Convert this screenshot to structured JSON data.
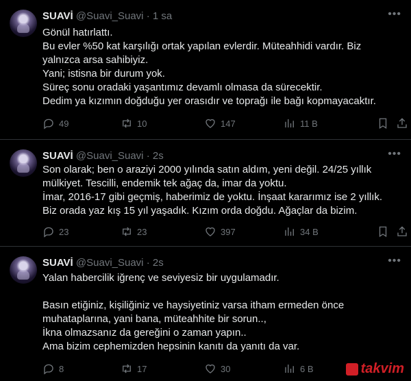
{
  "tweets": [
    {
      "name": "SUAVİ",
      "handle": "@Suavi_Suavi",
      "separator": "·",
      "time": "1 sa",
      "lines": [
        "Gönül hatırlattı.",
        "Bu evler %50 kat karşılığı ortak yapılan evlerdir. Müteahhidi vardır. Biz",
        "yalnızca arsa sahibiyiz.",
        "Yani; istisna bir durum yok.",
        "Süreç sonu oradaki yaşantımız devamlı olmasa da sürecektir.",
        "Dedim ya kızımın doğduğu yer orasıdır ve toprağı ile bağı kopmayacaktır."
      ],
      "replies": "49",
      "reposts": "10",
      "likes": "147",
      "views": "11 B"
    },
    {
      "name": "SUAVİ",
      "handle": "@Suavi_Suavi",
      "separator": "·",
      "time": "2s",
      "lines": [
        "Son olarak; ben o araziyi 2000 yılında satın aldım, yeni değil. 24/25 yıllık",
        "mülkiyet. Tescilli, endemik tek ağaç da, imar da yoktu.",
        "İmar, 2016-17 gibi geçmiş, haberimiz de yoktu. İnşaat kararımız ise 2 yıllık.",
        "Biz orada yaz kış 15 yıl yaşadık. Kızım orda doğdu. Ağaçlar da bizim."
      ],
      "replies": "23",
      "reposts": "23",
      "likes": "397",
      "views": "34 B"
    },
    {
      "name": "SUAVİ",
      "handle": "@Suavi_Suavi",
      "separator": "·",
      "time": "2s",
      "lines": [
        "Yalan habercilik iğrenç ve seviyesiz bir uygulamadır.",
        "",
        "Basın etiğiniz, kişiliğiniz ve haysiyetiniz varsa itham ermeden önce",
        "muhataplarına, yani bana, müteahhite bir sorun..,",
        "İkna olmazsanız da gereğini o zaman yapın..",
        "Ama bizim cephemizden hepsinin kanıtı da yanıtı da var."
      ],
      "replies": "8",
      "reposts": "17",
      "likes": "30",
      "views": "6 B"
    }
  ],
  "watermark": "takvim",
  "colors": {
    "background": "#000000",
    "text": "#e7e9ea",
    "muted": "#71767b",
    "border": "#2f3336",
    "watermark": "#d11f26"
  }
}
